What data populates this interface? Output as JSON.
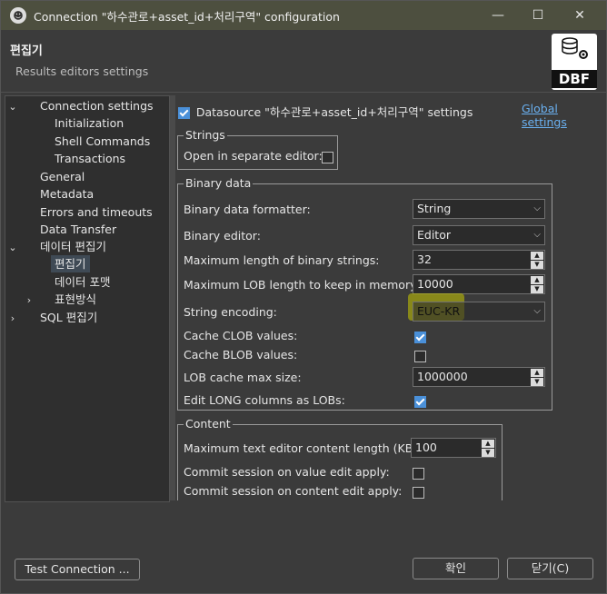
{
  "window": {
    "title": "Connection \"하수관로+asset_id+처리구역\" configuration",
    "minimize": "—",
    "maximize": "☐",
    "close": "✕"
  },
  "header": {
    "title": "편집기",
    "subtitle": "Results editors settings",
    "logo_text": "DBF"
  },
  "tree": {
    "items": [
      {
        "label": "Connection settings"
      },
      {
        "label": "Initialization"
      },
      {
        "label": "Shell Commands"
      },
      {
        "label": "Transactions"
      },
      {
        "label": "General"
      },
      {
        "label": "Metadata"
      },
      {
        "label": "Errors and timeouts"
      },
      {
        "label": "Data Transfer"
      },
      {
        "label": "데이터 편집기"
      },
      {
        "label": "편집기"
      },
      {
        "label": "데이터 포맷"
      },
      {
        "label": "표현방식"
      },
      {
        "label": "SQL 편집기"
      }
    ]
  },
  "settings": {
    "datasource_label": "Datasource \"하수관로+asset_id+처리구역\" settings",
    "datasource_checked": true,
    "global_link": "Global settings"
  },
  "strings_group": {
    "title": "Strings",
    "open_separate_label": "Open in separate editor:",
    "open_separate_checked": false
  },
  "binary_group": {
    "title": "Binary data",
    "formatter_label": "Binary data formatter:",
    "formatter_value": "String",
    "editor_label": "Binary editor:",
    "editor_value": "Editor",
    "max_len_label": "Maximum length of binary strings:",
    "max_len_value": "32",
    "max_lob_label": "Maximum LOB length to keep in memory:",
    "max_lob_value": "10000",
    "encoding_label": "String encoding:",
    "encoding_value": "EUC-KR",
    "clob_label": "Cache CLOB values:",
    "clob_checked": true,
    "blob_label": "Cache BLOB values:",
    "blob_checked": false,
    "lob_cache_label": "LOB cache max size:",
    "lob_cache_value": "1000000",
    "long_lobs_label": "Edit LONG columns as LOBs:",
    "long_lobs_checked": true
  },
  "content_group": {
    "title": "Content",
    "max_text_label": "Maximum text editor content length (KB):",
    "max_text_value": "100",
    "commit_value_label": "Commit session on value edit apply:",
    "commit_value_checked": false,
    "commit_content_label": "Commit session on content edit apply:",
    "commit_content_checked": false
  },
  "footer": {
    "test_connection": "Test Connection ...",
    "ok": "확인",
    "close": "닫기(C)"
  },
  "colors": {
    "highlight": "#c8c800",
    "accent": "#4a90d9"
  }
}
